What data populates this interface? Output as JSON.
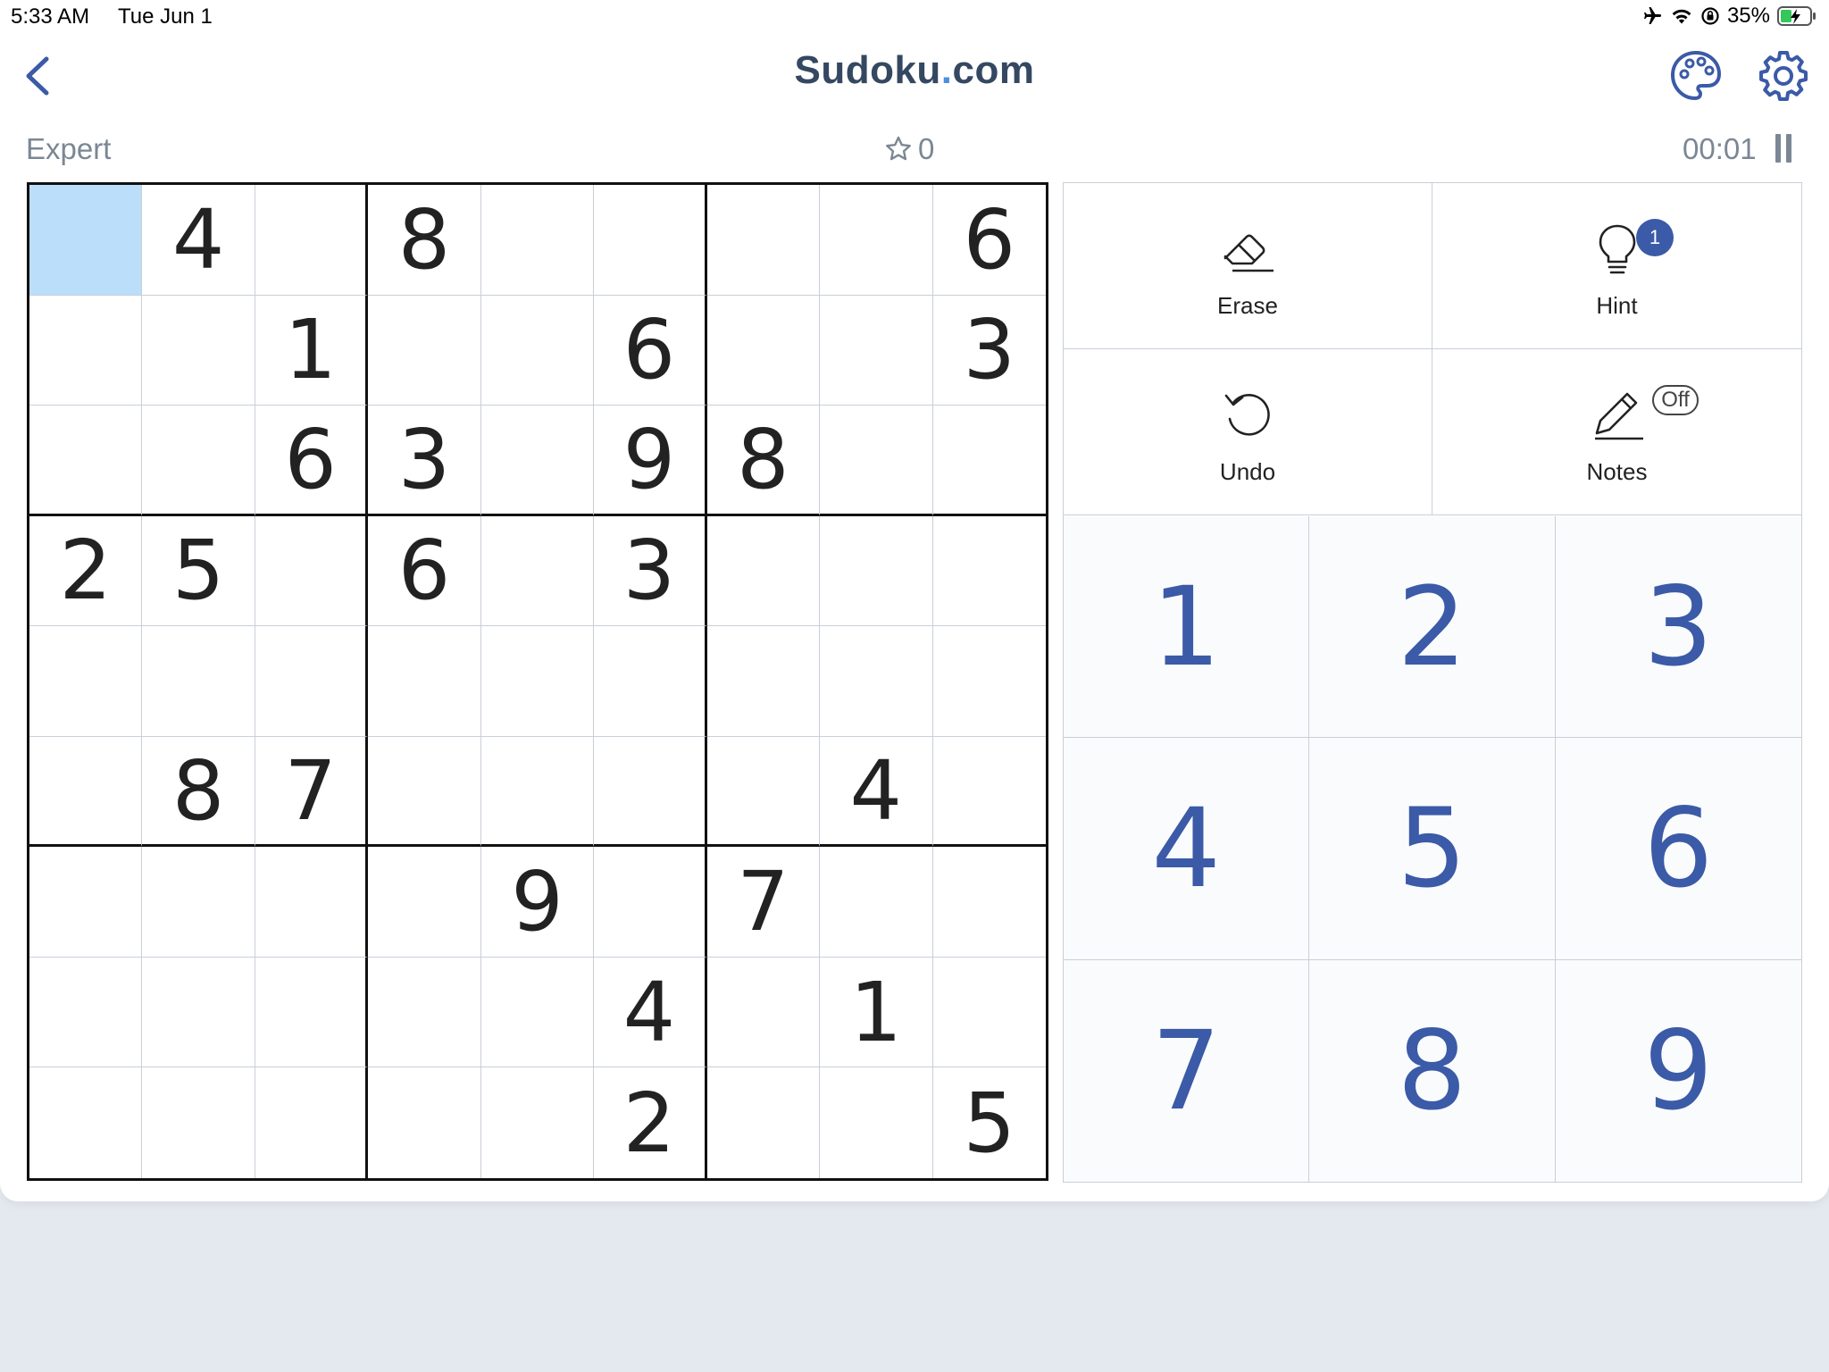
{
  "status_bar": {
    "time": "5:33 AM",
    "date": "Tue Jun 1",
    "battery": "35%",
    "icons": [
      "airplane-icon",
      "wifi-icon",
      "orientation-lock-icon",
      "battery-charging-icon"
    ]
  },
  "header": {
    "title_main": "Sudoku",
    "title_dot": ".",
    "title_suffix": "com",
    "back_icon": "chevron-left-icon",
    "palette_icon": "palette-icon",
    "settings_icon": "gear-icon",
    "accent_color": "#3b5aa7"
  },
  "game_info": {
    "difficulty": "Expert",
    "score": "0",
    "score_icon": "star-outline-icon",
    "timer": "00:01",
    "pause_icon": "pause-icon"
  },
  "board": {
    "selected_cell": [
      0,
      0
    ],
    "selected_color": "#bbdefb",
    "cells": [
      [
        "",
        "4",
        "",
        "8",
        "",
        "",
        "",
        "",
        "6"
      ],
      [
        "",
        "",
        "1",
        "",
        "",
        "6",
        "",
        "",
        "3"
      ],
      [
        "",
        "",
        "6",
        "3",
        "",
        "9",
        "8",
        "",
        ""
      ],
      [
        "2",
        "5",
        "",
        "6",
        "",
        "3",
        "",
        "",
        ""
      ],
      [
        "",
        "",
        "",
        "",
        "",
        "",
        "",
        "",
        ""
      ],
      [
        "",
        "8",
        "7",
        "",
        "",
        "",
        "",
        "4",
        ""
      ],
      [
        "",
        "",
        "",
        "",
        "9",
        "",
        "7",
        "",
        ""
      ],
      [
        "",
        "",
        "",
        "",
        "",
        "4",
        "",
        "1",
        ""
      ],
      [
        "",
        "",
        "",
        "",
        "",
        "2",
        "",
        "",
        "5"
      ]
    ]
  },
  "controls": {
    "erase": {
      "label": "Erase",
      "icon": "eraser-icon"
    },
    "hint": {
      "label": "Hint",
      "icon": "lightbulb-icon",
      "badge": "1"
    },
    "undo": {
      "label": "Undo",
      "icon": "undo-icon"
    },
    "notes": {
      "label": "Notes",
      "icon": "pencil-icon",
      "toggle": "Off"
    }
  },
  "numpad": [
    "1",
    "2",
    "3",
    "4",
    "5",
    "6",
    "7",
    "8",
    "9"
  ]
}
